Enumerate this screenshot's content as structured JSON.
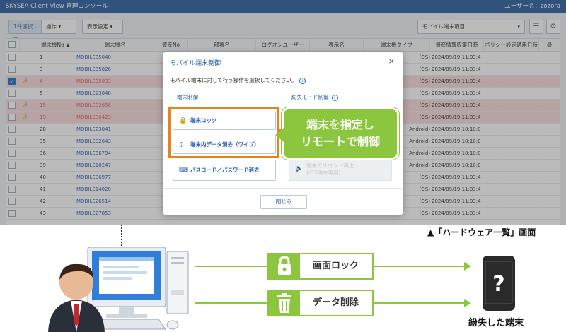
{
  "app": {
    "title": "SKYSEA Client View 管理コンソール",
    "user": "ユーザー名：zozora"
  },
  "toolbar": {
    "selected": "1件選択中",
    "operation": "操作 ▾",
    "display": "表示設定 ▾",
    "view_select": "モバイル端末項目",
    "view_caret": "▾",
    "list_icon": "☰",
    "settings_icon": "⚙"
  },
  "table": {
    "headers": {
      "no": "端末機No ▲",
      "name": "端末機名",
      "asset": "資産No",
      "dept": "部署名",
      "logon": "ログオンユーザー",
      "display": "表示名",
      "type": "端末機タイプ",
      "date": "資産情報収集日時",
      "policy": "ポリシー設定適用日時"
    },
    "rows": [
      {
        "no": "1",
        "name": "MOBILE35040",
        "os": "(OS)",
        "date": "2024/09/19 11:03:42",
        "pol": "-",
        "dash": "-",
        "checked": false,
        "warn": false,
        "hl": false
      },
      {
        "no": "3",
        "name": "MOBILE35026",
        "os": "(OS)",
        "date": "2024/09/19 11:03:42",
        "pol": "-",
        "dash": "-",
        "checked": false,
        "warn": false,
        "hl": false
      },
      {
        "no": "4",
        "name": "MOBILE35033",
        "os": "(OS)",
        "date": "2024/09/19 11:03:42",
        "pol": "-",
        "dash": "-",
        "checked": true,
        "warn": true,
        "hl": true
      },
      {
        "no": "5",
        "name": "MOBILE23040",
        "os": "(OS)",
        "date": "2024/09/19 11:03:42",
        "pol": "-",
        "dash": "-",
        "checked": false,
        "warn": false,
        "hl": false
      },
      {
        "no": "15",
        "name": "MOBILE02656",
        "os": "(OS)",
        "date": "2024/09/19 11:03:42",
        "pol": "-",
        "dash": "-",
        "checked": false,
        "warn": true,
        "hl": true
      },
      {
        "no": "19",
        "name": "MOBILE06423",
        "os": "(OS)",
        "date": "2024/09/19 11:03:42",
        "pol": "-",
        "dash": "-",
        "checked": false,
        "warn": true,
        "hl": true
      },
      {
        "no": "28",
        "name": "MOBILE23041",
        "os": "Android)",
        "date": "2024/09/19 10:10:00",
        "pol": "-",
        "dash": "-",
        "checked": false,
        "warn": false,
        "hl": false
      },
      {
        "no": "35",
        "name": "MOBILE02643",
        "os": "Android)",
        "date": "2024/09/19 10:10:00",
        "pol": "-",
        "dash": "-",
        "checked": false,
        "warn": false,
        "hl": false
      },
      {
        "no": "36",
        "name": "MOBILE06794",
        "os": "Android)",
        "date": "2024/09/19 10:10:00",
        "pol": "-",
        "dash": "-",
        "checked": false,
        "warn": false,
        "hl": false
      },
      {
        "no": "39",
        "name": "MOBILE10247",
        "os": "Android)",
        "date": "2024/09/19 10:10:00",
        "pol": "-",
        "dash": "-",
        "checked": false,
        "warn": false,
        "hl": false
      },
      {
        "no": "40",
        "name": "MOBILE06977",
        "os": "(OS)",
        "date": "2024/09/19 11:03:42",
        "pol": "-",
        "dash": "-",
        "checked": false,
        "warn": false,
        "hl": false
      },
      {
        "no": "41",
        "name": "MOBILE14020",
        "os": "(OS)",
        "date": "2024/09/19 11:03:42",
        "pol": "-",
        "dash": "-",
        "checked": false,
        "warn": false,
        "hl": false
      },
      {
        "no": "42",
        "name": "MOBILE26514",
        "os": "(OS)",
        "date": "2024/09/19 11:03:42",
        "pol": "-",
        "dash": "-",
        "checked": false,
        "warn": false,
        "hl": false
      },
      {
        "no": "43",
        "name": "MOBILE27853",
        "os": "(OS)",
        "date": "2024/09/19 11:03:42",
        "pol": "-",
        "dash": "-",
        "checked": false,
        "warn": false,
        "hl": false
      }
    ]
  },
  "modal": {
    "title": "モバイル端末制御",
    "close": "×",
    "desc": "モバイル端末に対して行う操作を選択してください。",
    "sec_left": "端末制御",
    "sec_right": "紛失モード制御",
    "btn_lock": "端末ロック",
    "btn_wipe": "端末内データ消去（ワイプ）",
    "btn_pass": "パスコード／パスワード消去",
    "btn_sound_1": "端末でサウンド再生",
    "btn_sound_2": "(iOS端末専用)",
    "close_btn": "閉じる"
  },
  "callout": {
    "line1": "端末を指定し",
    "line2": "リモートで制御"
  },
  "caption": "▲「ハードウェア一覧」画面",
  "actions": {
    "lock": "画面ロック",
    "delete": "データ削除"
  },
  "lost_device": "紛失した端末",
  "colors": {
    "accent_green": "#8cc63f",
    "orange": "#e8821e",
    "titlebar": "#2c5f9e",
    "highlight_row": "#f9dada"
  }
}
